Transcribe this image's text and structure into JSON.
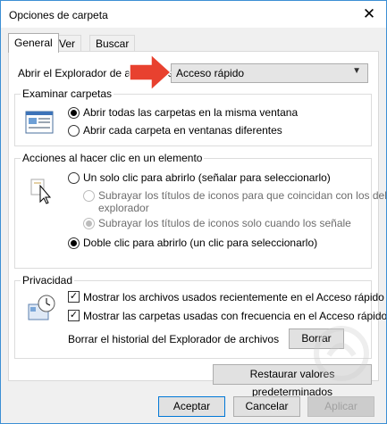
{
  "window": {
    "title": "Opciones de carpeta",
    "close_glyph": "✕"
  },
  "tabs": [
    {
      "label": "General",
      "active": true
    },
    {
      "label": "Ver",
      "active": false
    },
    {
      "label": "Buscar",
      "active": false
    }
  ],
  "open_explorer": {
    "label": "Abrir el Explorador de archivos en:",
    "value": "Acceso rápido"
  },
  "browse_folders": {
    "title": "Examinar carpetas",
    "options": [
      {
        "label": "Abrir todas las carpetas en la misma ventana",
        "checked": true
      },
      {
        "label": "Abrir cada carpeta en ventanas diferentes",
        "checked": false
      }
    ]
  },
  "click_actions": {
    "title": "Acciones al hacer clic en un elemento",
    "single_click": "Un solo clic para abrirlo (señalar para seleccionarlo)",
    "underline_consistent_line1": "Subrayar los títulos de iconos para que coincidan con los del",
    "underline_consistent_line2": "explorador",
    "underline_hover": "Subrayar los títulos de iconos solo cuando los señale",
    "double_click": "Doble clic para abrirlo (un clic para seleccionarlo)"
  },
  "privacy": {
    "title": "Privacidad",
    "recent_files": "Mostrar los archivos usados recientemente en el Acceso rápido",
    "frequent_folders": "Mostrar las carpetas usadas con frecuencia en el Acceso rápido",
    "clear_history_label": "Borrar el historial del Explorador de archivos",
    "clear_button": "Borrar"
  },
  "restore_defaults": "Restaurar valores predeterminados",
  "footer": {
    "accept": "Aceptar",
    "cancel": "Cancelar",
    "apply": "Aplicar"
  },
  "colors": {
    "accent": "#0078d7",
    "arrow": "#e8412f",
    "watermark": "#cfcfcf"
  }
}
